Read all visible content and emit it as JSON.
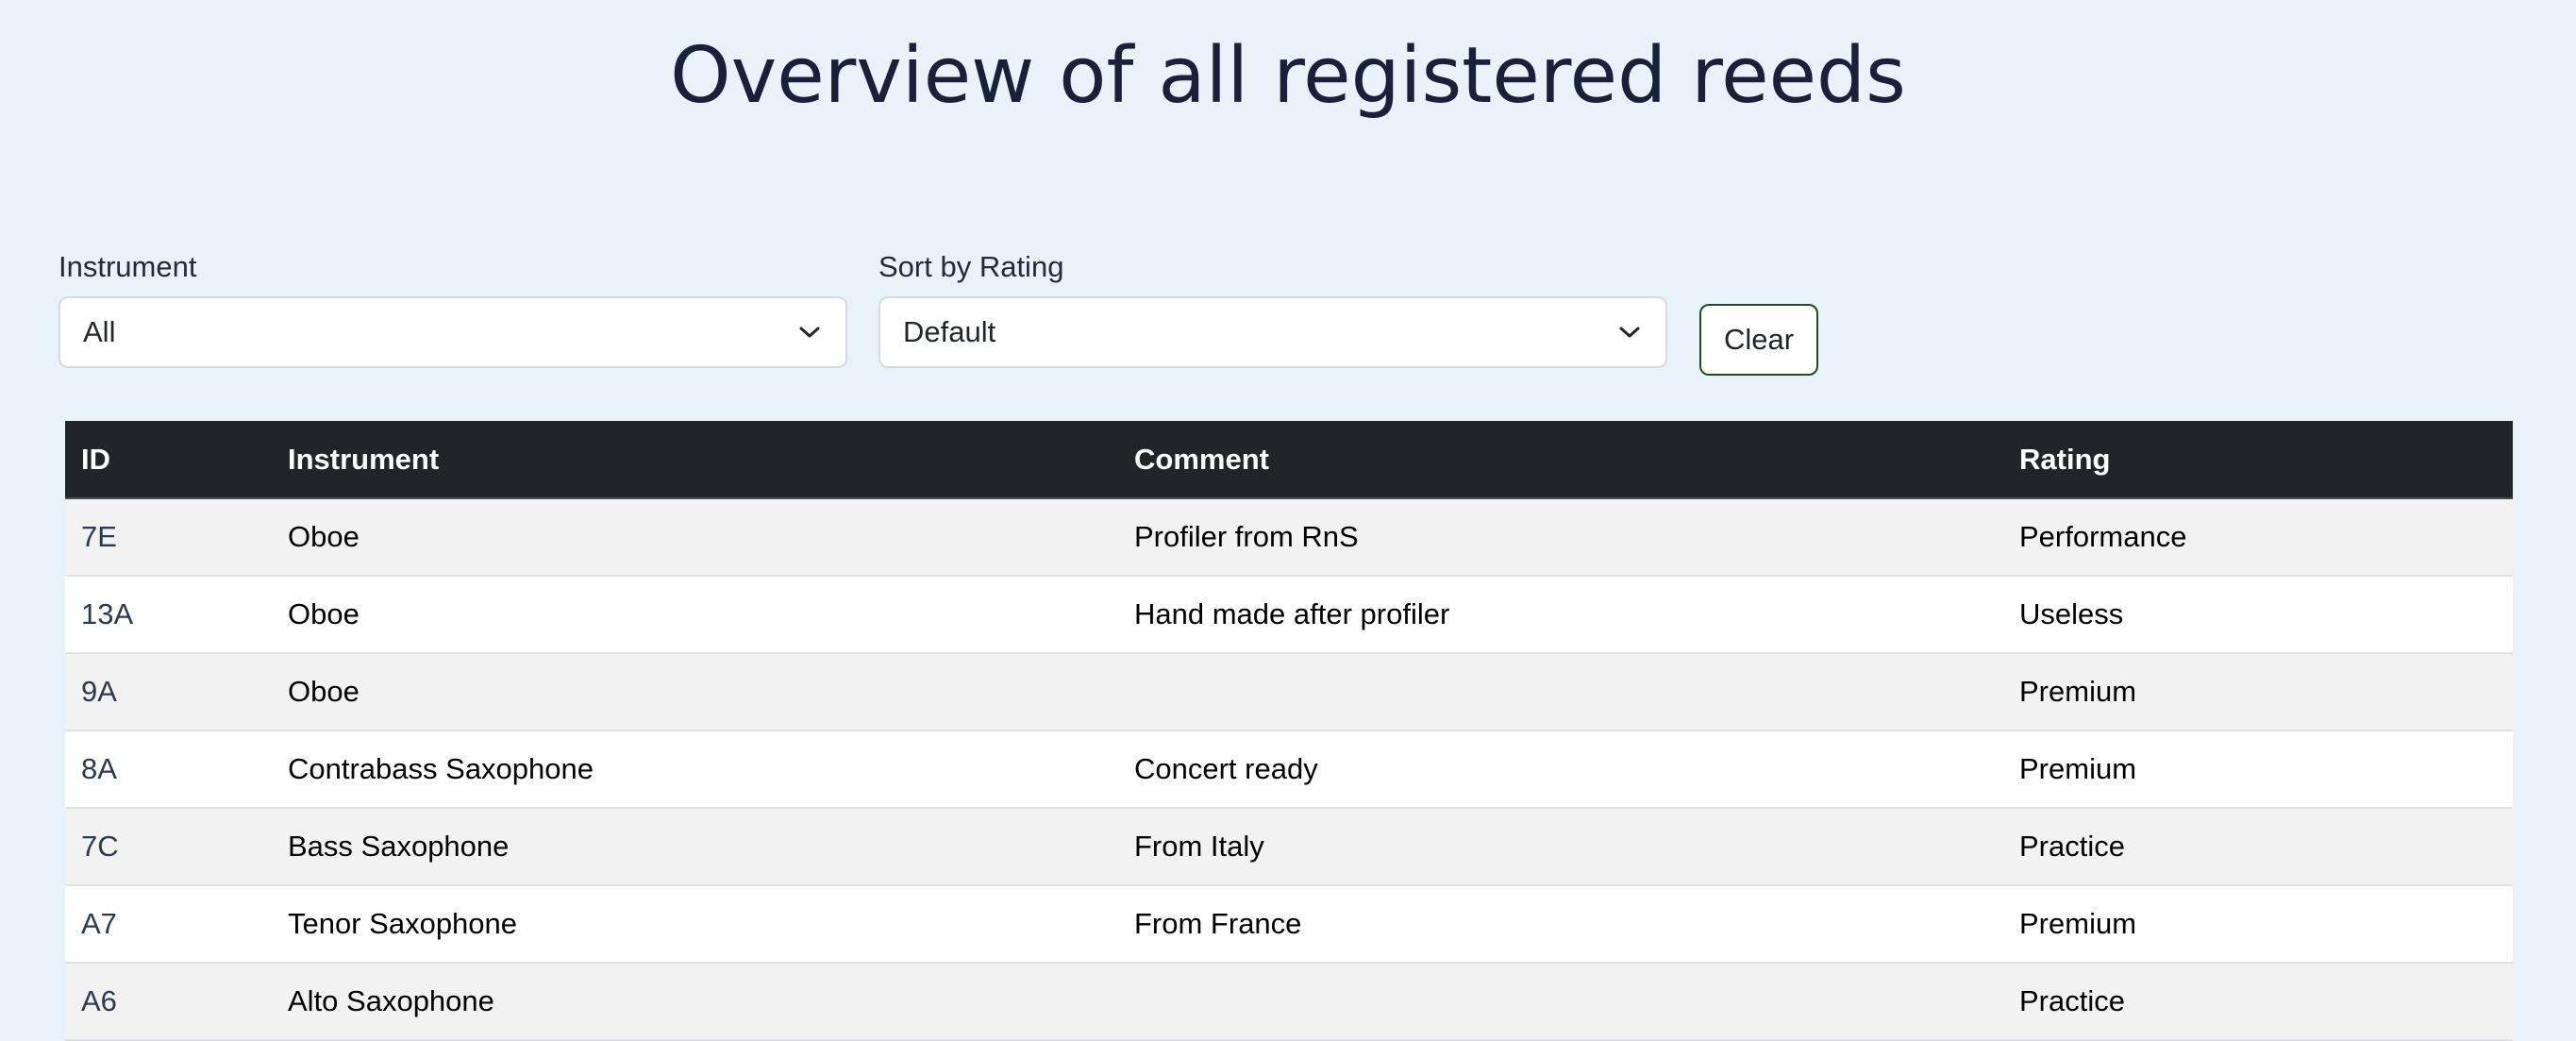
{
  "page": {
    "title": "Overview of all registered reeds"
  },
  "filters": {
    "instrument": {
      "label": "Instrument",
      "selected": "All"
    },
    "sort": {
      "label": "Sort by Rating",
      "selected": "Default"
    },
    "clear_label": "Clear"
  },
  "table": {
    "headers": [
      "ID",
      "Instrument",
      "Comment",
      "Rating"
    ],
    "rows": [
      {
        "id": "7E",
        "instrument": "Oboe",
        "comment": "Profiler from RnS",
        "rating": "Performance"
      },
      {
        "id": "13A",
        "instrument": "Oboe",
        "comment": "Hand made after profiler",
        "rating": "Useless"
      },
      {
        "id": "9A",
        "instrument": "Oboe",
        "comment": "",
        "rating": "Premium"
      },
      {
        "id": "8A",
        "instrument": "Contrabass Saxophone",
        "comment": "Concert ready",
        "rating": "Premium"
      },
      {
        "id": "7C",
        "instrument": "Bass Saxophone",
        "comment": "From Italy",
        "rating": "Practice"
      },
      {
        "id": "A7",
        "instrument": "Tenor Saxophone",
        "comment": "From France",
        "rating": "Premium"
      },
      {
        "id": "A6",
        "instrument": "Alto Saxophone",
        "comment": "",
        "rating": "Practice"
      }
    ]
  },
  "colors": {
    "background": "#e8f2f9",
    "table_header": "#212529",
    "clear_border": "#1f4d1f"
  },
  "icons": {
    "dropdown": "chevron-down-icon"
  }
}
